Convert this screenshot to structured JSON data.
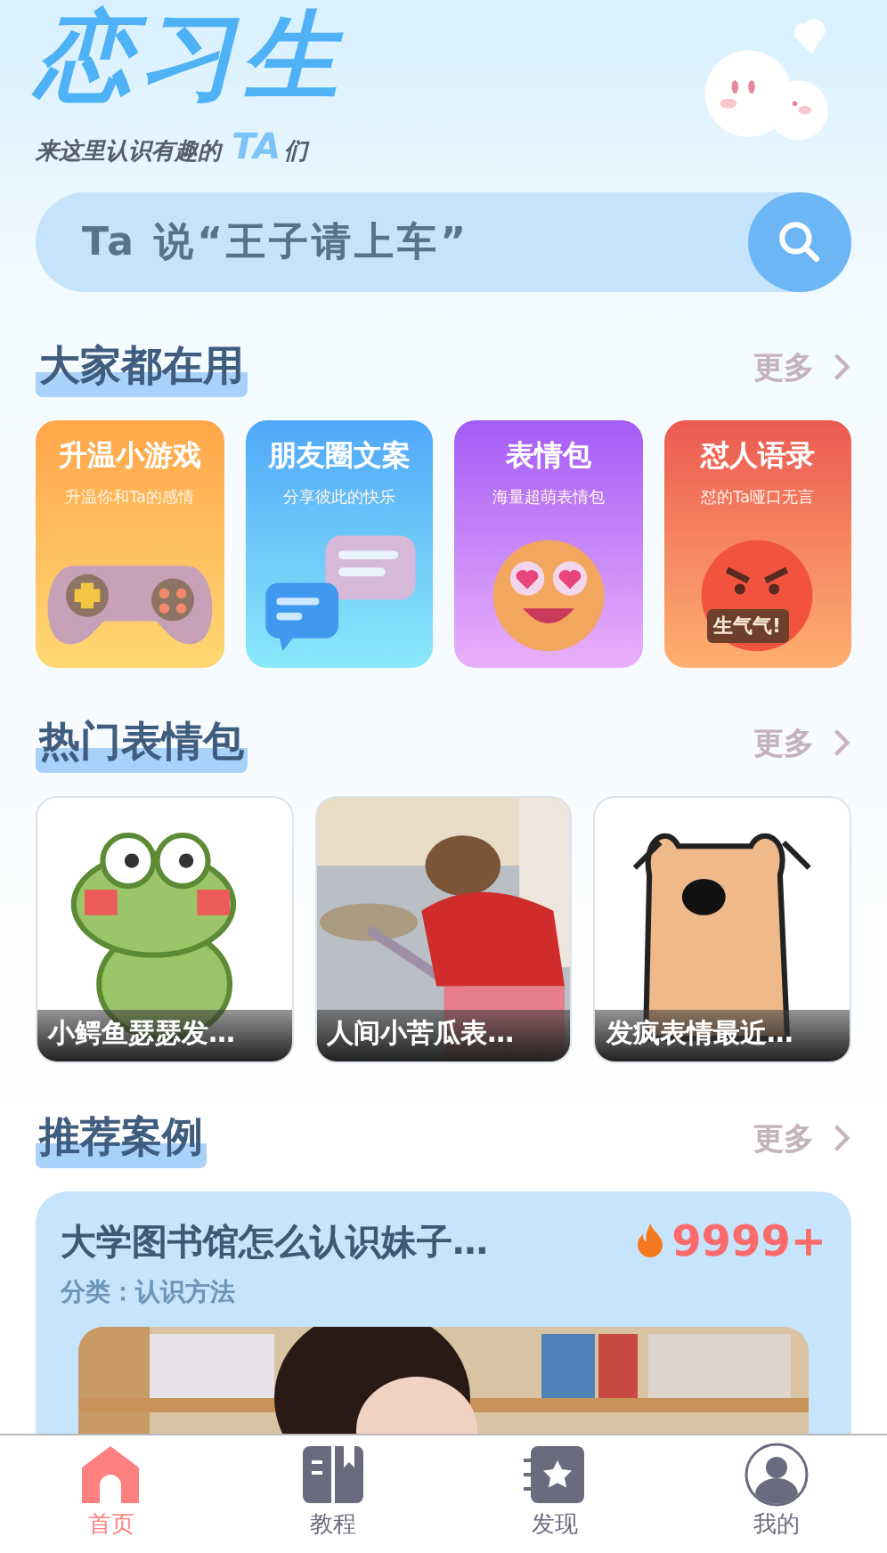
{
  "header": {
    "logo": "恋习生",
    "tagline": "来这里认识有趣的",
    "tagline_highlight": "TA",
    "tagline_suffix": "们"
  },
  "search": {
    "placeholder": "Ta 说“王子请上车”"
  },
  "popular": {
    "title": "大家都在用",
    "more": "更多",
    "items": [
      {
        "kind": "game",
        "title": "升温小游戏",
        "subtitle": "升温你和Ta的感情"
      },
      {
        "kind": "chat",
        "title": "朋友圈文案",
        "subtitle": "分享彼此的快乐"
      },
      {
        "kind": "emoji",
        "title": "表情包",
        "subtitle": "海量超萌表情包"
      },
      {
        "kind": "angry",
        "title": "怼人语录",
        "subtitle": "怼的Ta哑口无言",
        "badge": "生气气!"
      }
    ]
  },
  "stickers": {
    "title": "热门表情包",
    "more": "更多",
    "items": [
      {
        "kind": "frog",
        "caption": "小鳄鱼瑟瑟发…"
      },
      {
        "kind": "picture",
        "caption": "人间小苦瓜表…"
      },
      {
        "kind": "dog",
        "caption": "发疯表情最近…"
      }
    ]
  },
  "cases": {
    "title": "推荐案例",
    "more": "更多",
    "items": [
      {
        "title": "大学图书馆怎么认识妹子…",
        "heat": "9999+",
        "category": "分类：认识方法"
      }
    ]
  },
  "tabs": [
    {
      "label": "首页",
      "kind": "home",
      "selected": true
    },
    {
      "label": "教程",
      "kind": "book",
      "selected": false
    },
    {
      "label": "发现",
      "kind": "discover",
      "selected": false
    },
    {
      "label": "我的",
      "kind": "user",
      "selected": false
    }
  ]
}
